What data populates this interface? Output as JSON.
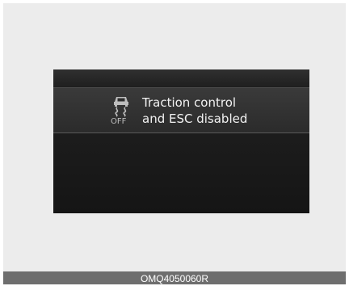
{
  "display": {
    "icon": "traction-control-off-icon",
    "icon_sub_label": "OFF",
    "message": {
      "line1": "Traction control",
      "line2": "and ESC disabled"
    }
  },
  "caption": {
    "code": "OMQ4050060R"
  },
  "colors": {
    "frame_background": "#ececec",
    "display_background": "#1d1d1d",
    "message_text": "#f2f2f2",
    "caption_bar": "#6e6e6e"
  }
}
